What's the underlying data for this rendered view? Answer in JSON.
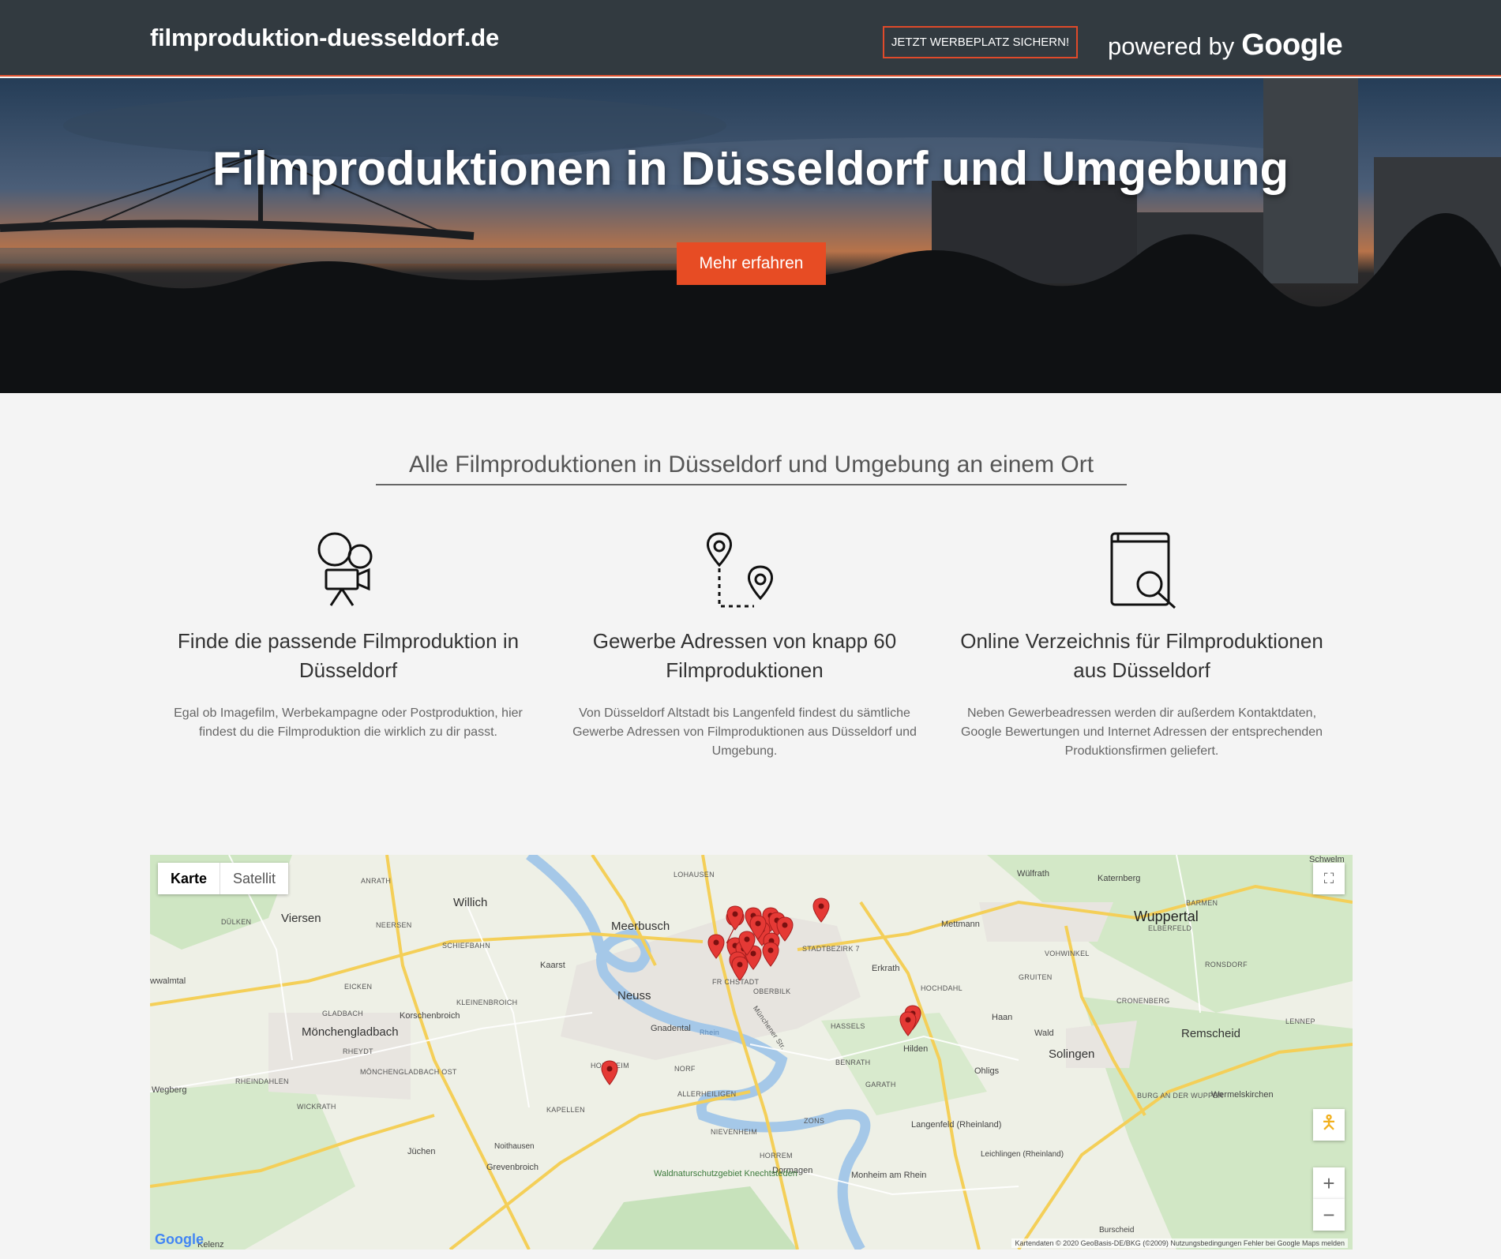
{
  "header": {
    "brand": "filmproduktion-duesseldorf.de",
    "cta": "JETZT WERBEPLATZ SICHERN!",
    "powered_by": "powered by",
    "google": "Google"
  },
  "hero": {
    "title": "Filmproduktionen in Düsseldorf und Umgebung",
    "button": "Mehr erfahren"
  },
  "intro": {
    "title": "Alle Filmproduktionen in Düsseldorf und Umgebung an einem Ort"
  },
  "features": [
    {
      "icon": "film-camera-icon",
      "title": "Finde die passende Filmproduktion in Düsseldorf",
      "text": "Egal ob Imagefilm, Werbekampagne oder Postproduktion, hier findest du die Filmproduktion die wirklich zu dir passt."
    },
    {
      "icon": "map-route-icon",
      "title": "Gewerbe Adressen von knapp 60 Filmproduktionen",
      "text": "Von Düsseldorf Altstadt bis Langenfeld findest du sämtliche Gewerbe Adressen von Filmproduktionen aus Düsseldorf und Umgebung."
    },
    {
      "icon": "directory-search-icon",
      "title": "Online Verzeichnis für Filmproduktionen aus Düsseldorf",
      "text": "Neben Gewerbeadressen werden dir außerdem Kontaktdaten, Google Bewertungen und Internet Adressen der entsprechenden Produktionsfirmen geliefert."
    }
  ],
  "map": {
    "type_options": [
      "Karte",
      "Satellit"
    ],
    "selected_type": "Karte",
    "labels": {
      "willich": "Willich",
      "viersen": "Viersen",
      "duelken": "DÜLKEN",
      "anrath": "ANRATH",
      "neersen": "NEERSEN",
      "schiefbahn": "SCHIEFBAHN",
      "meerbusch": "Meerbusch",
      "kaarst": "Kaarst",
      "neuss": "Neuss",
      "lohausen": "LOHAUSEN",
      "stadtbezirk7": "STADTBEZIRK 7",
      "erkrath": "Erkrath",
      "mettmann": "Mettmann",
      "wuelfrath": "Wülfrath",
      "katernberg": "Katernberg",
      "wuppertal": "Wuppertal",
      "barmen": "BARMEN",
      "elberfeld": "ELBERFELD",
      "vohwinkel": "VOHWINKEL",
      "gruiten": "GRUITEN",
      "ronsdorf": "RONSDORF",
      "cronenberg": "CRONENBERG",
      "hochdahl": "HOCHDAHL",
      "haan": "Haan",
      "wald": "Wald",
      "solingen": "Solingen",
      "ohligs": "Ohligs",
      "remscheid": "Remscheid",
      "lennep": "LENNEP",
      "burg": "BURG AN DER WUPPER",
      "wermelskirchen": "Wermelskirchen",
      "hilden": "Hilden",
      "langenfeld": "Langenfeld (Rheinland)",
      "leichlingen": "Leichlingen (Rheinland)",
      "monheim": "Monheim am Rhein",
      "burscheid": "Burscheid",
      "dormagen": "Dormagen",
      "waldnatur": "Waldnaturschutzgebiet Knechtsteden",
      "grevenbroich": "Grevenbroich",
      "juechen": "Jüchen",
      "noithausen": "Noithausen",
      "kapellen": "KAPELLEN",
      "wickrath": "WICKRATH",
      "wegberg": "Wegberg",
      "moenchengladbach": "Mönchengladbach",
      "gladbach": "GLADBACH",
      "rheydt": "RHEYDT",
      "rheindahlen": "RHEINDAHLEN",
      "mgost": "MÖNCHENGLADBACH OST",
      "korschenbroich": "Korschenbroich",
      "kleinenbroich": "KLEINENBROICH",
      "eicken": "EICKEN",
      "schwalmtal": "wwalmtal",
      "gnadental": "Gnadental",
      "holzheim": "HOLZHEIM",
      "norf": "NORF",
      "allerheiligen": "ALLERHEILIGEN",
      "nievenheim": "NIEVENHEIM",
      "zons": "ZONS",
      "hassels": "HASSELS",
      "benrath": "BENRATH",
      "garath": "GARATH",
      "friedrichstadt": "FR    CHSTADT",
      "oberbilk": "OBERBILK",
      "horrem": "HORREM",
      "schwelm": "Schwelm",
      "kelenz": "Kelenz",
      "rhein": "Rhein",
      "muenchener": "Münchener Str."
    },
    "attribution": "Kartendaten © 2020 GeoBasis-DE/BKG (©2009)   Nutzungsbedingungen   Fehler bei Google Maps melden",
    "google_logo": "Google"
  }
}
